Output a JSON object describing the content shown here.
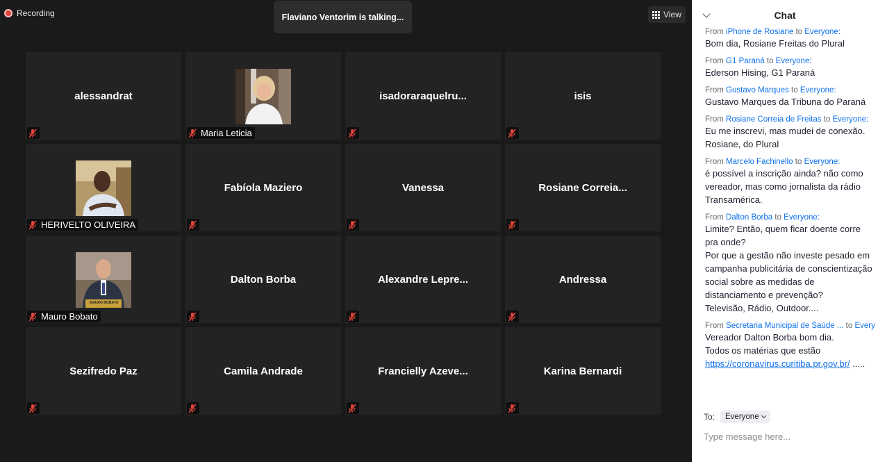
{
  "recording": {
    "label": "Recording"
  },
  "talking": "Flaviano Ventorim is talking...",
  "view_button": {
    "label": "View"
  },
  "participants": [
    {
      "name": "alessandrat"
    },
    {
      "name": "Maria Leticia"
    },
    {
      "name": "isadoraraquelru..."
    },
    {
      "name": "isis"
    },
    {
      "name": "HERIVELTO OLIVEIRA"
    },
    {
      "name": "Fabíola Maziero"
    },
    {
      "name": "Vanessa"
    },
    {
      "name": "Rosiane  Correia..."
    },
    {
      "name": "Mauro Bobato"
    },
    {
      "name": "Dalton Borba"
    },
    {
      "name": "Alexandre  Lepre..."
    },
    {
      "name": "Andressa"
    },
    {
      "name": "Sezifredo Paz"
    },
    {
      "name": "Camila Andrade"
    },
    {
      "name": "Francielly  Azeve..."
    },
    {
      "name": "Karina Bernardi"
    }
  ],
  "avatar_badge": "MAURO BOBATO",
  "chat": {
    "title": "Chat",
    "messages": [
      {
        "from_prefix": "From",
        "sender": "iPhone de Rosiane",
        "to_word": "to",
        "recipient": "Everyone:",
        "lines": [
          "Bom dia, Rosiane Freitas do Plural"
        ]
      },
      {
        "from_prefix": "From",
        "sender": "G1 Paraná",
        "to_word": "to",
        "recipient": "Everyone:",
        "lines": [
          "Ederson Hising, G1 Paraná"
        ]
      },
      {
        "from_prefix": "From",
        "sender": "Gustavo Marques",
        "to_word": "to",
        "recipient": "Everyone:",
        "lines": [
          "Gustavo Marques da Tribuna do Paraná"
        ]
      },
      {
        "from_prefix": "From",
        "sender": "Rosiane Correia de Freitas",
        "to_word": "to",
        "recipient": "Everyone:",
        "lines": [
          "Eu me inscrevi, mas mudei de conexão.",
          "Rosiane, do Plural"
        ]
      },
      {
        "from_prefix": "From",
        "sender": "Marcelo Fachinello",
        "to_word": "to",
        "recipient": "Everyone:",
        "lines": [
          "é possível a inscrição ainda? não como",
          "vereador, mas como jornalista da rádio",
          "Transamérica."
        ]
      },
      {
        "from_prefix": "From",
        "sender": "Dalton Borba",
        "to_word": "to",
        "recipient": "Everyone:",
        "lines": [
          "Limite? Então, quem ficar doente corre",
          "pra onde?",
          "Por que a gestão não investe pesado em",
          "campanha publicitária de conscientização",
          "social sobre as medidas de",
          "distanciamento e prevenção?",
          "Televisão, Rádio, Outdoor...."
        ]
      },
      {
        "from_prefix": "From",
        "sender": "Secretaria Municipal de Saúde ...",
        "to_word": "to",
        "recipient": "Every",
        "lines": [
          "Vereador Dalton Borba  bom dia.",
          "Todos os matérias que estão"
        ],
        "link": "https://coronavirus.curitiba.pr.gov.br/",
        "link_suffix": " ....."
      }
    ],
    "to_label": "To:",
    "to_value": "Everyone",
    "input_placeholder": "Type message here..."
  }
}
